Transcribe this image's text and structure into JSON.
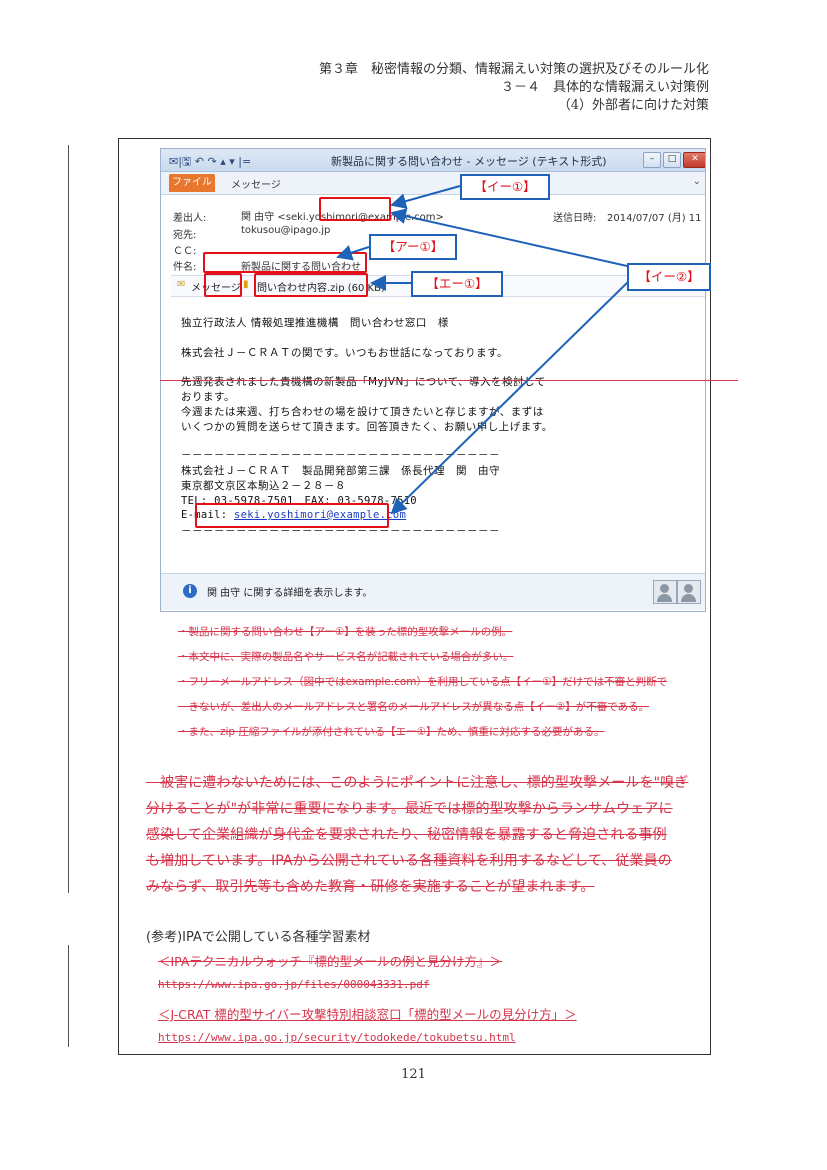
{
  "header": {
    "line1": "第３章　秘密情報の分類、情報漏えい対策の選択及びそのルール化",
    "line2": "３－４　具体的な情報漏えい対策例",
    "line3": "（4）外部者に向けた対策"
  },
  "email_window": {
    "title": "新製品に関する問い合わせ - メッセージ (テキスト形式)",
    "qat_icons": "✉|🖫 ↶ ↷ ▴ ▾ |=",
    "file_tab": "ファイル",
    "message_tab": "メッセージ",
    "from_label": "差出人:",
    "from_value": "関 由守 <seki.yoshimori@example.com>",
    "sent_label": "送信日時:",
    "sent_value": "2014/07/07 (月) 11",
    "to_label": "宛先:",
    "to_value": "tokusou@ipago.jp",
    "cc_label": "ＣＣ:",
    "subject_label": "件名:",
    "subject_value": "新製品に関する問い合わせ",
    "attach_message": "メッセージ",
    "attach_file": "問い合わせ内容.zip (60 KB)",
    "body_lines": [
      "独立行政法人 情報処理推進機構　問い合わせ窓口　様",
      "株式会社Ｊ－ＣＲＡＴの関です。いつもお世話になっております。",
      "先週発表されました貴機構の新製品「MyJVN」について、導入を検討して",
      "おります。",
      "今週または来週、打ち合わせの場を設けて頂きたいと存じますが、まずは",
      "いくつかの質問を送らせて頂きます。回答頂きたく、お願い申し上げます。",
      "－－－－－－－－－－－－－－－－－－－－－－－－－－－－－",
      "株式会社Ｊ－ＣＲＡＴ　製品開発部第三課　係長代理　関　由守",
      "東京都文京区本駒込２－２８－８",
      "TEL: 03-5978-7501　FAX: 03-5978-7510",
      "－－－－－－－－－－－－－－－－－－－－－－－－－－－－－"
    ],
    "email_prefix": "E-mail: ",
    "email_link": "seki.yoshimori@example.com",
    "info_text": "関 由守 に関する詳細を表示します。"
  },
  "callouts": {
    "i1": "【イー①】",
    "a1": "【アー①】",
    "e1": "【エー①】",
    "i2": "【イー②】"
  },
  "notes": [
    "・製品に関する問い合わせ【アー①】を装った標的型攻撃メールの例。",
    "・本文中に、実際の製品名やサービス名が記載されている場合が多い。",
    "・フリーメールアドレス（図中ではexample.com）を利用している点【イー①】だけでは不審と判断で",
    "　きないが、差出人のメールアドレスと署名のメールアドレスが異なる点【イー②】が不審である。",
    "・また、zip 圧縮ファイルが添付されている【エー①】ため、慎重に対応する必要がある。"
  ],
  "paragraph": [
    "　被害に遭わないためには、このようにポイントに注意し、標的型攻撃メールを\"嗅ぎ",
    "分けることが\"が非常に重要になります。最近では標的型攻撃からランサムウェアに",
    "感染して企業組織が身代金を要求されたり、秘密情報を暴露すると脅迫される事例",
    "も増加しています。IPAから公開されている各種資料を利用するなどして、従業員の",
    "みならず、取引先等も含めた教育・研修を実施することが望まれます。"
  ],
  "references": {
    "title": "(参考)IPAで公開している各種学習素材",
    "ref1_title": "＜IPAテクニカルウォッチ『標的型メールの例と見分け方』＞",
    "ref1_url": "https://www.ipa.go.jp/files/000043331.pdf",
    "ref2_title": "＜J-CRAT 標的型サイバー攻撃特別相談窓口「標的型メールの見分け方」＞",
    "ref2_url": "https://www.ipa.go.jp/security/todokede/tokubetsu.html"
  },
  "page_number": "121",
  "colors": {
    "callout_border": "#1e63b8",
    "highlight": "#e3101a",
    "revision_text": "#d6344a"
  }
}
